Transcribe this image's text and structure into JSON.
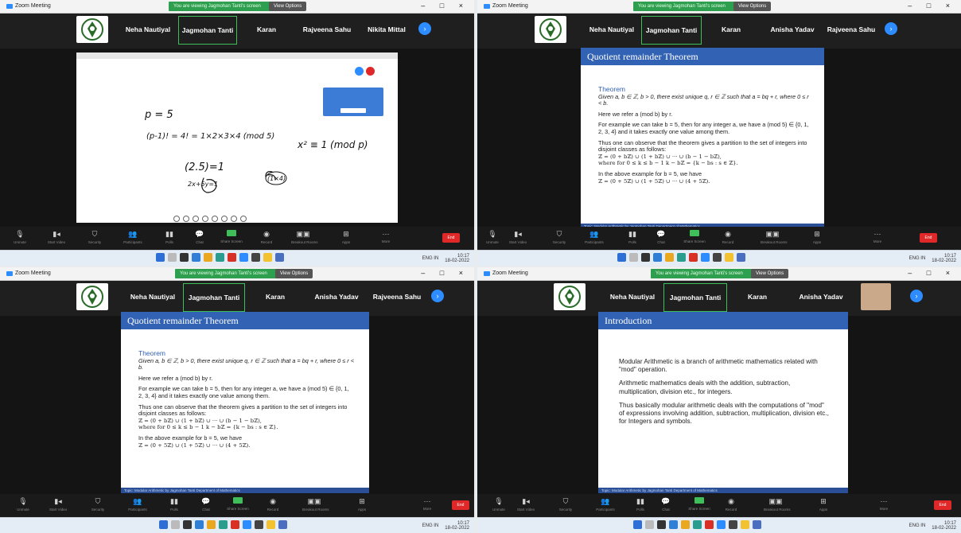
{
  "window": {
    "app_name": "Zoom Meeting",
    "share_banner": "You are viewing Jagmohan Tanti's screen",
    "view_button": "View Options",
    "window_controls": "– □ ×"
  },
  "participants": {
    "q1": [
      "Neha Nautiyal",
      "Jagmohan Tanti",
      "Karan",
      "Rajveena Sahu",
      "Nikita Mittal"
    ],
    "q2": [
      "Neha Nautiyal",
      "Jagmohan Tanti",
      "Karan",
      "Anisha Yadav",
      "Rajveena Sahu"
    ],
    "q3": [
      "Neha Nautiyal",
      "Jagmohan Tanti",
      "Karan",
      "Anisha Yadav",
      "Rajveena Sahu"
    ],
    "q4": [
      "Neha Nautiyal",
      "Jagmohan Tanti",
      "Karan",
      "Anisha Yadav"
    ]
  },
  "whiteboard": {
    "line1": "p = 5",
    "line2": "(p-1)! = 4! = 1×2×3×4 (mod 5)",
    "line3": "(2.5)=1",
    "line4": "2x+5y=1",
    "line5": "x² ≡ 1 (mod p)",
    "line6": "(1×4)"
  },
  "slide_theorem": {
    "title": "Quotient remainder Theorem",
    "theorem_heading": "Theorem",
    "statement": "Given a, b ∈ ℤ, b > 0, there exist unique q, r ∈ ℤ such that a = bq + r, where 0 ≤ r < b.",
    "p1": "Here we refer a (mod b) by r.",
    "p2": "For example we can take b = 5, then for any integer a, we have a (mod 5) ∈ {0, 1, 2, 3, 4} and it takes exactly one value among them.",
    "p3": "Thus one can observe that the theorem gives a partition to the set of integers into disjoint classes as follows:",
    "p3_math": "ℤ = (0 + bℤ) ∪ (1 + bℤ) ∪ ··· ∪ (b − 1 − bℤ),",
    "p3_math2": "where for 0 ≤ k ≤ b − 1 k − bℤ = {k − bs : s ∈ ℤ}.",
    "p4": "In the above example for b = 5, we have",
    "p4_math": "ℤ = (0 + 5ℤ) ∪ (1 + 5ℤ) ∪ ··· ∪ (4 + 5ℤ).",
    "footer": "Topic: Modular Arithmetic   by Jagmohan Tanti   Department of Mathematics"
  },
  "slide_intro": {
    "title": "Introduction",
    "p1": "Modular Arithmetic is a branch of arithmetic mathematics related with \"mod\" operation.",
    "p2": "Arithmetic mathematics deals with the addition, subtraction, multiplication, division etc., for integers.",
    "p3": "Thus basically modular arithmetic deals with the computations of \"mod\" of expressions involving addition, subtraction, multiplication, division etc., for Integers and symbols.",
    "footer": "Topic: Modular Arithmetic   by Jagmohan Tanti   Department of Mathematics"
  },
  "toolbar": {
    "mute": "Unmute",
    "video": "Start Video",
    "security": "Security",
    "participants": "Participants",
    "polls": "Polls",
    "chat": "Chat",
    "share": "Share Screen",
    "record": "Record",
    "rooms": "Breakout Rooms",
    "apps": "Apps",
    "more": "More",
    "end": "End"
  },
  "taskbar": {
    "lang": "ENG IN",
    "time": "10:17",
    "date": "18-02-2022"
  },
  "colors": {
    "slide_title_bg": "#3262b4",
    "zoom_blue": "#2d8cff",
    "zoom_green": "#3fbf5a",
    "end_red": "#e02828"
  }
}
